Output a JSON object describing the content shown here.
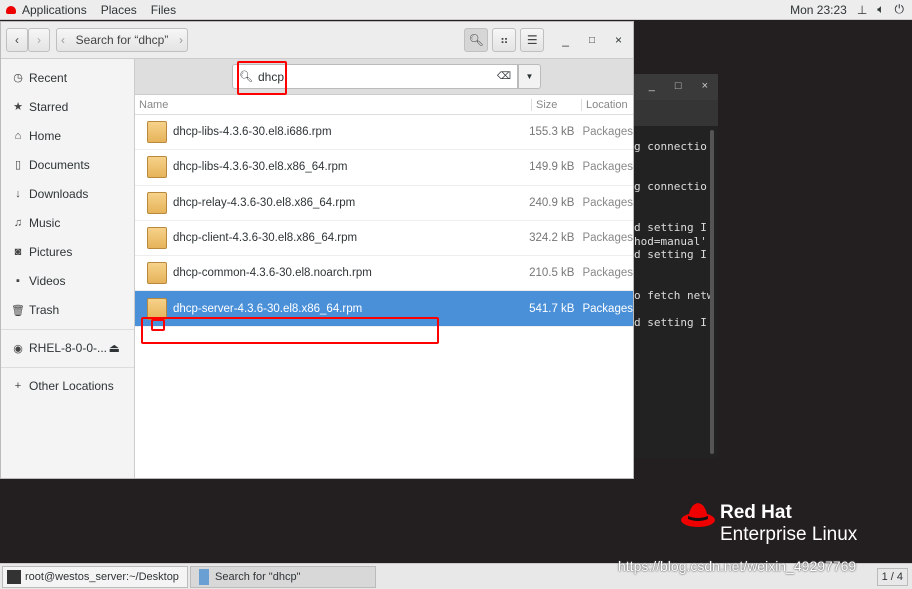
{
  "topbar": {
    "applications": "Applications",
    "places": "Places",
    "files": "Files",
    "clock": "Mon 23:23"
  },
  "terminal": {
    "lines": [
      "",
      "g connectio",
      "",
      "",
      "g connectio",
      "",
      "",
      "d setting I",
      "hod=manual'",
      "d setting I",
      "",
      "",
      "o fetch netw",
      "",
      "d setting I"
    ]
  },
  "window": {
    "path_label": "Search for “dhcp”",
    "search_value": "dhcp"
  },
  "sidebar": {
    "items": [
      {
        "label": "Recent",
        "icon": "clock-icon"
      },
      {
        "label": "Starred",
        "icon": "star-icon"
      },
      {
        "label": "Home",
        "icon": "home-icon"
      },
      {
        "label": "Documents",
        "icon": "document-icon"
      },
      {
        "label": "Downloads",
        "icon": "download-icon"
      },
      {
        "label": "Music",
        "icon": "music-icon"
      },
      {
        "label": "Pictures",
        "icon": "camera-icon"
      },
      {
        "label": "Videos",
        "icon": "video-icon"
      },
      {
        "label": "Trash",
        "icon": "trash-icon"
      }
    ],
    "device": "RHEL-8-0-0-...",
    "other": "Other Locations"
  },
  "columns": {
    "name": "Name",
    "size": "Size",
    "location": "Location"
  },
  "files": [
    {
      "name": "dhcp-libs-4.3.6-30.el8.i686.rpm",
      "size": "155.3 kB",
      "location": "Packages"
    },
    {
      "name": "dhcp-libs-4.3.6-30.el8.x86_64.rpm",
      "size": "149.9 kB",
      "location": "Packages"
    },
    {
      "name": "dhcp-relay-4.3.6-30.el8.x86_64.rpm",
      "size": "240.9 kB",
      "location": "Packages"
    },
    {
      "name": "dhcp-client-4.3.6-30.el8.x86_64.rpm",
      "size": "324.2 kB",
      "location": "Packages"
    },
    {
      "name": "dhcp-common-4.3.6-30.el8.noarch.rpm",
      "size": "210.5 kB",
      "location": "Packages"
    },
    {
      "name": "dhcp-server-4.3.6-30.el8.x86_64.rpm",
      "size": "541.7 kB",
      "location": "Packages",
      "selected": true
    }
  ],
  "logo": {
    "line1": "Red Hat",
    "line2": "Enterprise Linux"
  },
  "taskbar": {
    "terminal": "root@westos_server:~/Desktop",
    "files": "Search for \"dhcp\"",
    "workspace": "1 / 4"
  },
  "watermark": "https://blog.csdn.net/weixin_49297769",
  "colors": {
    "selection": "#4a90d9",
    "highlight": "#ff0000",
    "brand": "#ee0000"
  }
}
